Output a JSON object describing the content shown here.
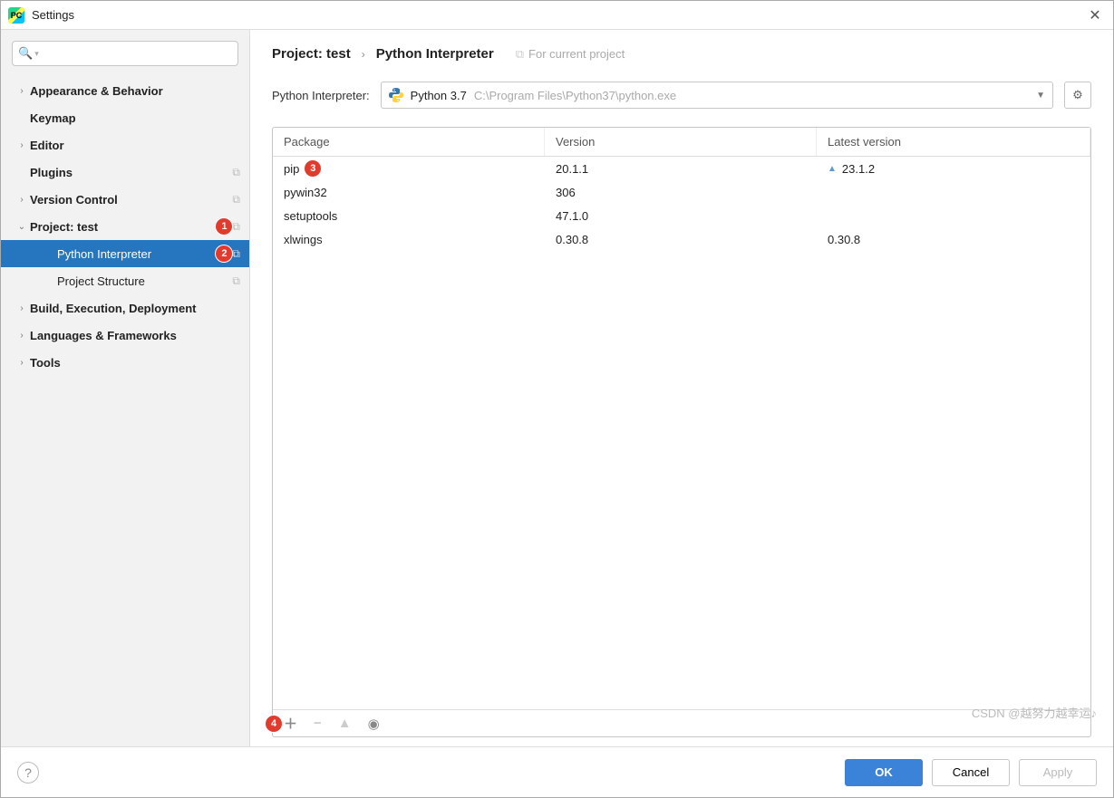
{
  "window": {
    "title": "Settings"
  },
  "search": {
    "placeholder": ""
  },
  "sidebar": {
    "items": [
      {
        "label": "Appearance & Behavior",
        "bold": true,
        "depth": 0,
        "expandable": true,
        "expanded": false,
        "copy": false
      },
      {
        "label": "Keymap",
        "bold": true,
        "depth": 0,
        "expandable": false,
        "copy": false
      },
      {
        "label": "Editor",
        "bold": true,
        "depth": 0,
        "expandable": true,
        "expanded": false,
        "copy": false
      },
      {
        "label": "Plugins",
        "bold": true,
        "depth": 0,
        "expandable": false,
        "copy": true
      },
      {
        "label": "Version Control",
        "bold": true,
        "depth": 0,
        "expandable": true,
        "expanded": false,
        "copy": true
      },
      {
        "label": "Project: test",
        "bold": true,
        "depth": 0,
        "expandable": true,
        "expanded": true,
        "copy": true,
        "badge": "1"
      },
      {
        "label": "Python Interpreter",
        "bold": false,
        "depth": 1,
        "expandable": false,
        "copy": true,
        "selected": true,
        "badge": "2"
      },
      {
        "label": "Project Structure",
        "bold": false,
        "depth": 1,
        "expandable": false,
        "copy": true
      },
      {
        "label": "Build, Execution, Deployment",
        "bold": true,
        "depth": 0,
        "expandable": true,
        "expanded": false,
        "copy": false
      },
      {
        "label": "Languages & Frameworks",
        "bold": true,
        "depth": 0,
        "expandable": true,
        "expanded": false,
        "copy": false
      },
      {
        "label": "Tools",
        "bold": true,
        "depth": 0,
        "expandable": true,
        "expanded": false,
        "copy": false
      }
    ]
  },
  "breadcrumb": {
    "item1": "Project: test",
    "item2": "Python Interpreter",
    "hint": "For current project"
  },
  "interpreter": {
    "label": "Python Interpreter:",
    "name": "Python 3.7",
    "path": "C:\\Program Files\\Python37\\python.exe"
  },
  "table": {
    "headers": {
      "package": "Package",
      "version": "Version",
      "latest": "Latest version"
    },
    "rows": [
      {
        "package": "pip",
        "version": "20.1.1",
        "latest": "23.1.2",
        "update": true,
        "badge": "3"
      },
      {
        "package": "pywin32",
        "version": "306",
        "latest": "",
        "update": false
      },
      {
        "package": "setuptools",
        "version": "47.1.0",
        "latest": "",
        "update": false
      },
      {
        "package": "xlwings",
        "version": "0.30.8",
        "latest": "0.30.8",
        "update": false
      }
    ]
  },
  "toolbar": {
    "add_badge": "4"
  },
  "footer": {
    "ok": "OK",
    "cancel": "Cancel",
    "apply": "Apply"
  },
  "watermark": "CSDN @越努力越幸运♪"
}
